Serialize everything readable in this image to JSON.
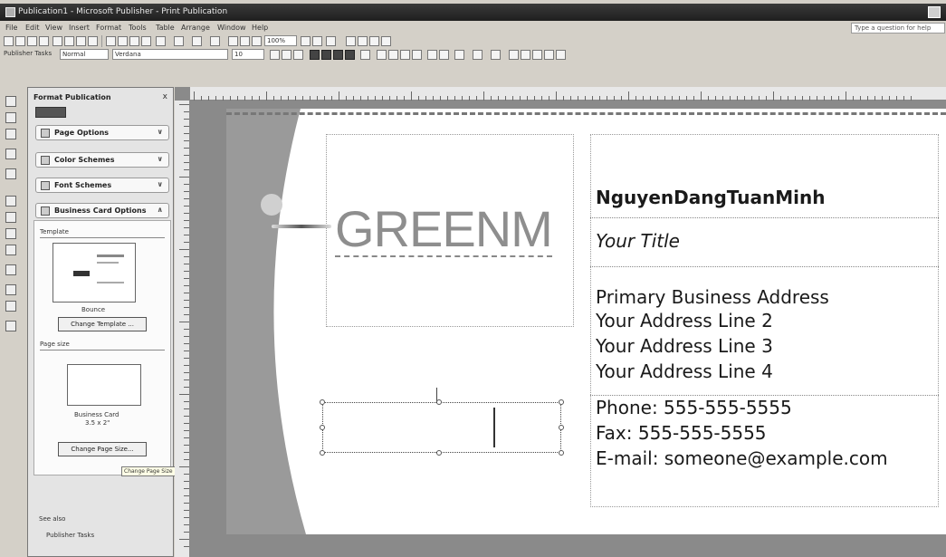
{
  "window": {
    "title": "Publication1 - Microsoft Publisher - Print Publication"
  },
  "menu": {
    "items": [
      "File",
      "Edit",
      "View",
      "Insert",
      "Format",
      "Tools",
      "Table",
      "Arrange",
      "Window",
      "Help"
    ],
    "help_placeholder": "Type a question for help"
  },
  "toolbar": {
    "zoom": "100%",
    "style": "Publisher Tasks",
    "style_value": "Normal",
    "font": "Verdana",
    "font_size": "10"
  },
  "task_pane": {
    "title": "Format Publication",
    "close": "x",
    "sections": {
      "page_options": "Page Options",
      "color_schemes": "Color Schemes",
      "font_schemes": "Font Schemes",
      "business_card_options": "Business Card Options"
    },
    "template_label": "Template",
    "template_name": "Bounce",
    "change_template": "Change Template ...",
    "page_size_label": "Page size",
    "page_size_name": "Business Card",
    "page_size_dims": "3.5 x 2\"",
    "change_page_size": "Change Page Size...",
    "tooltip": "Change Page Size",
    "see_also": "See also",
    "publisher_tasks": "Publisher Tasks"
  },
  "card": {
    "logo_text": "GREENM",
    "name": "NguyenDangTuanMinh",
    "title": "Your Title",
    "address": [
      "Primary Business Address",
      "Your Address Line 2",
      "Your Address Line 3",
      "Your Address Line 4"
    ],
    "phone": "Phone: 555-555-5555",
    "fax": "Fax: 555-555-5555",
    "email": "E-mail: someone@example.com"
  },
  "colors": {
    "title_bar": "#2b2b2b",
    "chrome": "#d4d0c8",
    "workspace": "#8a8a8a",
    "logo": "#8e8e8e"
  }
}
